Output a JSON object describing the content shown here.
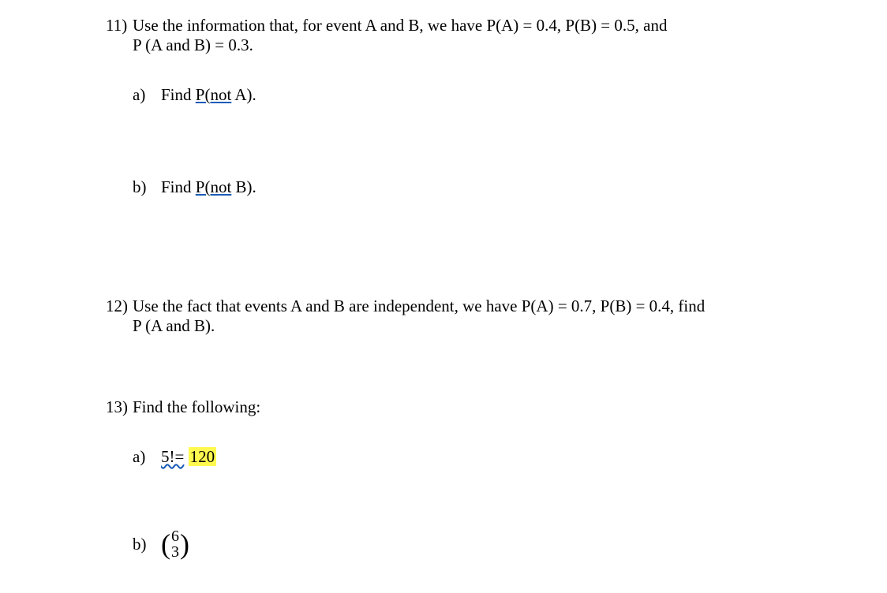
{
  "q11": {
    "number": "11)",
    "text_line1": "Use the information that, for event A and B, we have P(A) = 0.4, P(B) = 0.5, and",
    "text_line2": "P (A and B) = 0.3.",
    "a_letter": "a)",
    "a_find": "Find ",
    "a_expr_pre": "P(",
    "a_expr_not": "not",
    "a_expr_post": " A).",
    "b_letter": "b)",
    "b_find": "Find ",
    "b_expr_pre": "P(",
    "b_expr_not": "not",
    "b_expr_post": " B)."
  },
  "q12": {
    "number": "12)",
    "text_line1": "Use the fact that events A and B are independent, we have P(A) = 0.7, P(B) = 0.4, find",
    "text_line2": "P (A and B)."
  },
  "q13": {
    "number": "13)",
    "text": "Find the following:",
    "a_letter": "a)",
    "a_expr": "5!=",
    "a_ans": "120",
    "b_letter": "b)",
    "b_top": "6",
    "b_bot": "3"
  }
}
